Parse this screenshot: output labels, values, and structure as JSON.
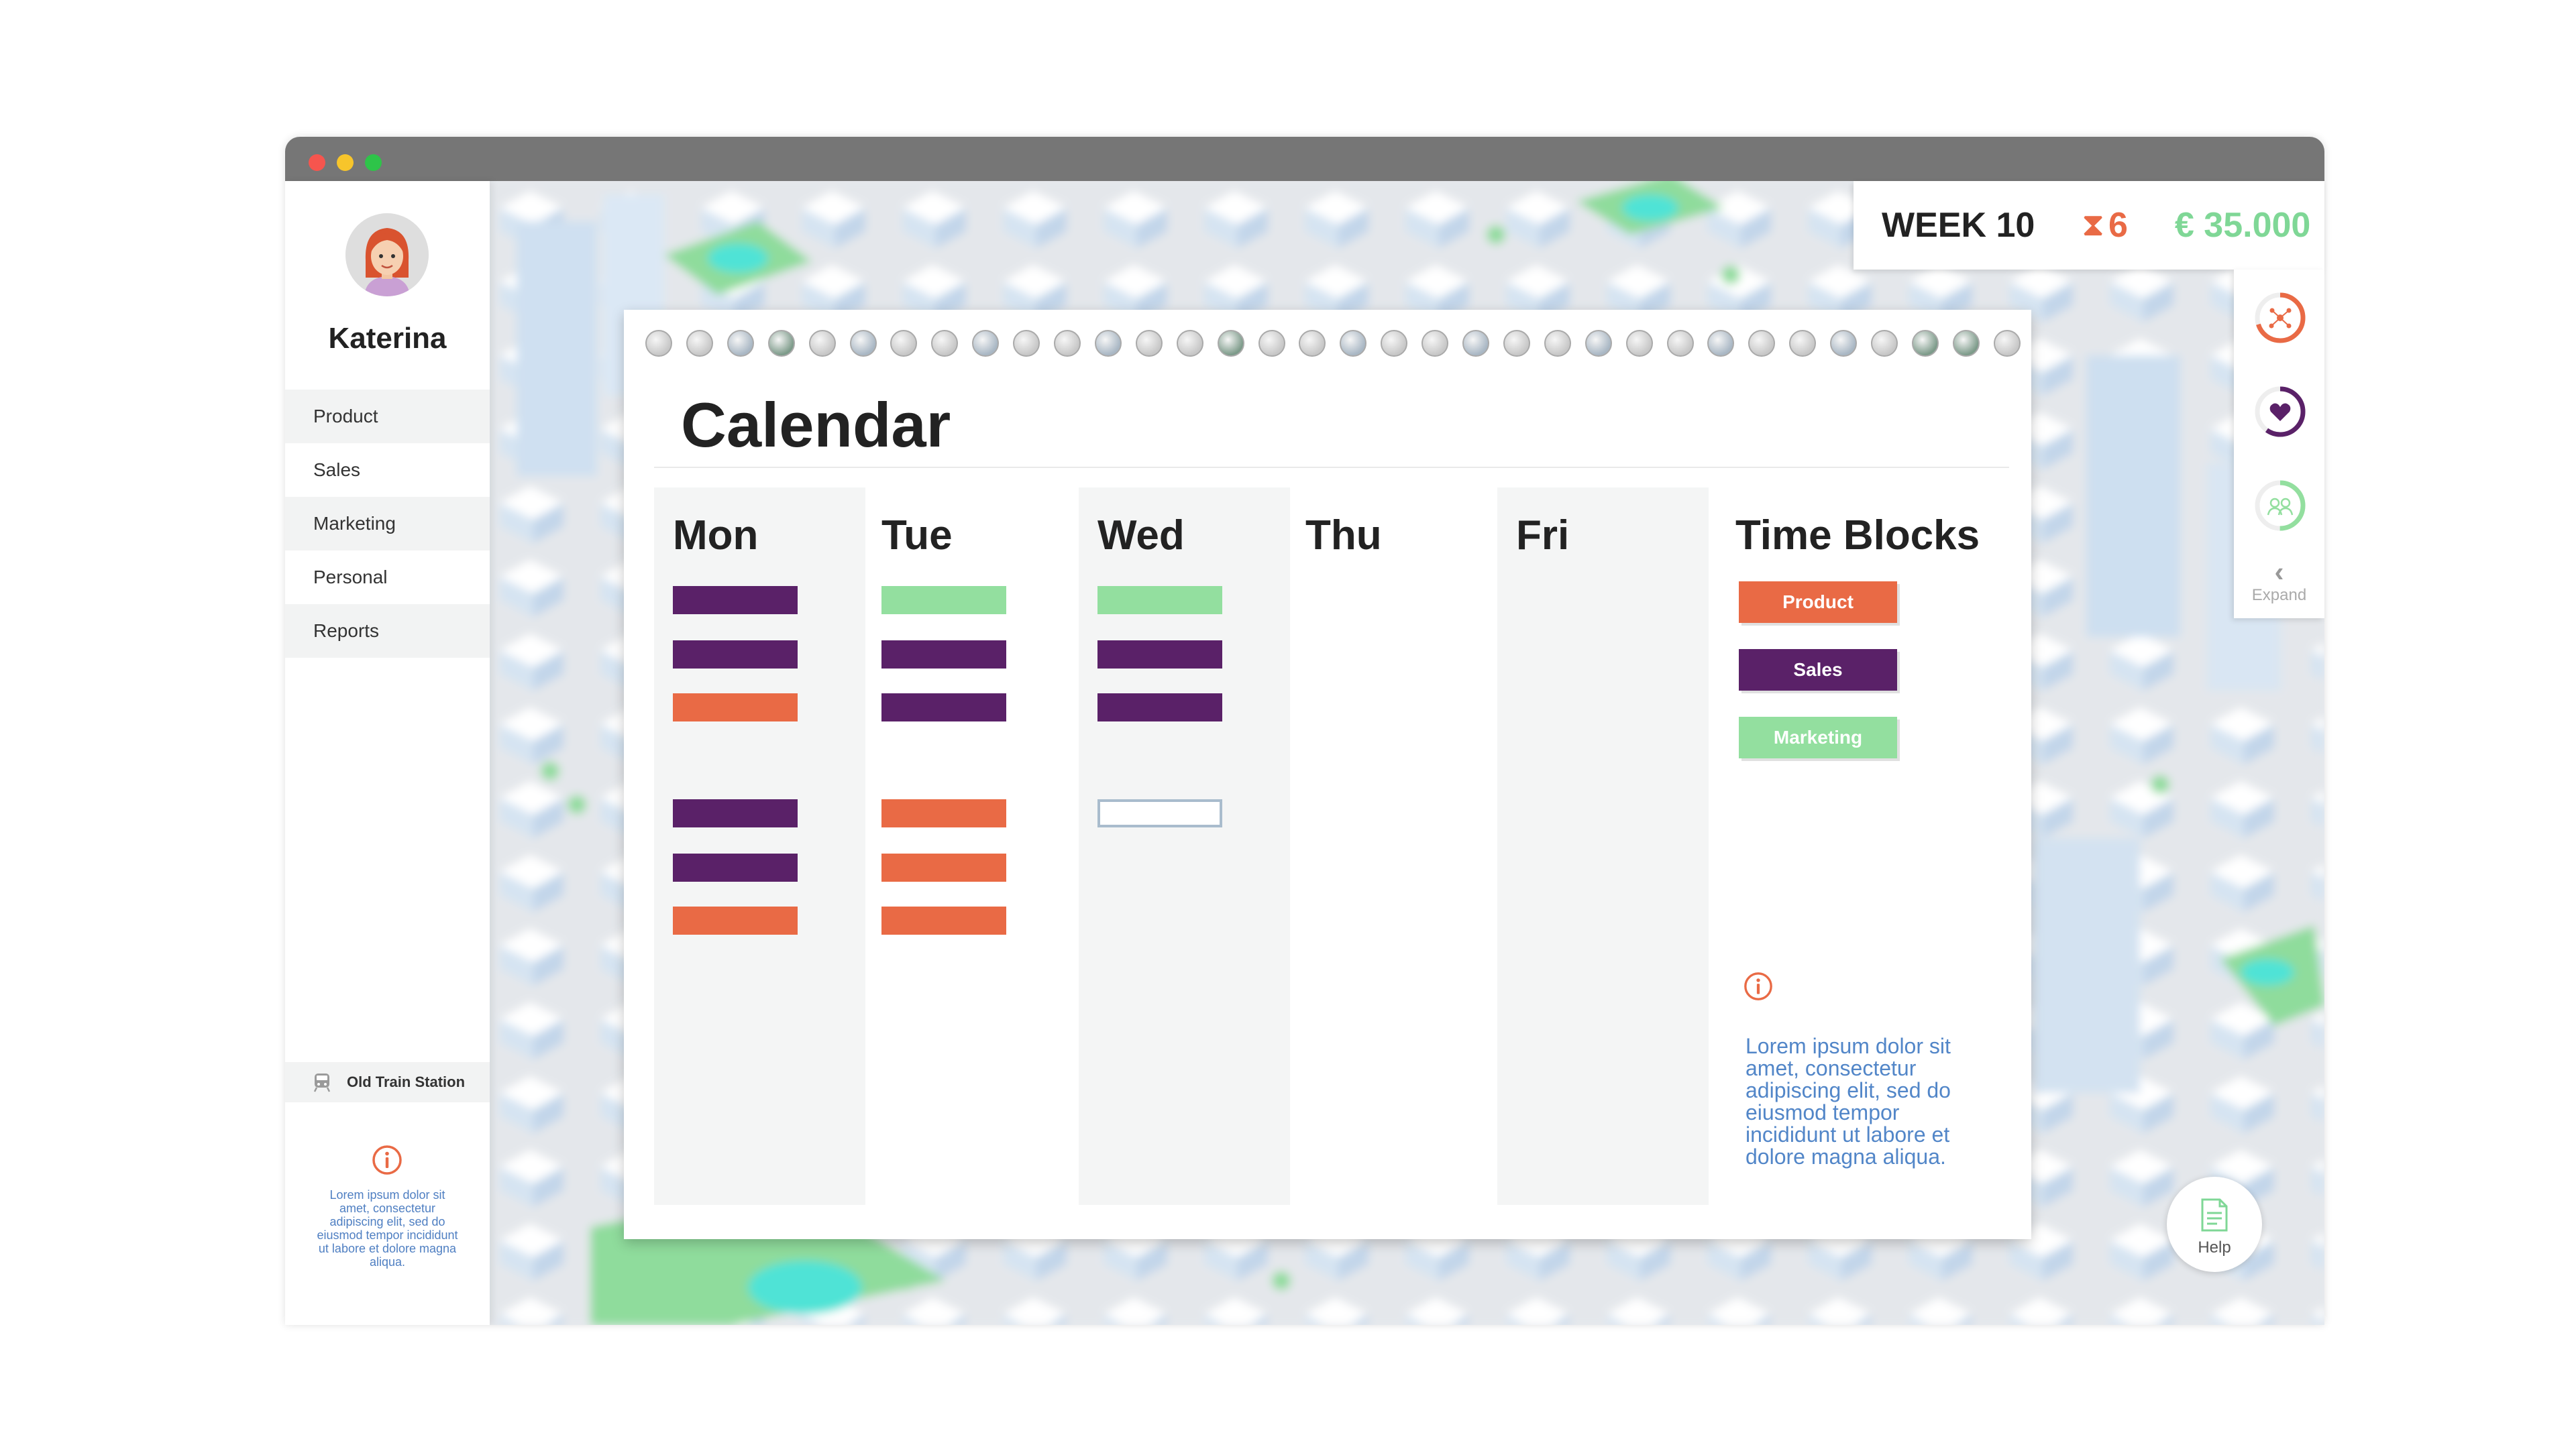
{
  "window": {
    "controls": [
      "close",
      "minimize",
      "maximize"
    ]
  },
  "user": {
    "name": "Katerina",
    "avatar_icon": "woman-avatar-icon"
  },
  "sidebar": {
    "items": [
      {
        "label": "Product"
      },
      {
        "label": "Sales"
      },
      {
        "label": "Marketing"
      },
      {
        "label": "Personal"
      },
      {
        "label": "Reports"
      }
    ],
    "location": {
      "label": "Old Train Station",
      "icon": "train-icon"
    },
    "info_icon": "info-icon",
    "info_text": "Lorem ipsum dolor sit amet, consectetur adipiscing elit, sed do eiusmod tempor incididunt ut labore et dolore magna aliqua."
  },
  "stats": {
    "week": "WEEK 10",
    "time_icon": "hourglass-icon",
    "time_left": "6",
    "money": "€ 35.000"
  },
  "meters": [
    {
      "icon": "network-icon",
      "color": "#e96a45",
      "level": 0.7
    },
    {
      "icon": "heart-icon",
      "color": "#5a2168",
      "level": 0.6
    },
    {
      "icon": "people-icon",
      "color": "#7fd796",
      "level": 0.5
    }
  ],
  "expand": {
    "label": "Expand",
    "icon": "chevron-left-icon"
  },
  "help": {
    "label": "Help",
    "icon": "document-icon"
  },
  "calendar": {
    "title": "Calendar",
    "days": [
      {
        "label": "Mon",
        "blocks": [
          "sales",
          "sales",
          "product",
          null,
          "sales",
          "sales",
          "product"
        ]
      },
      {
        "label": "Tue",
        "blocks": [
          "marketing",
          "sales",
          "sales",
          null,
          "product",
          "product",
          "product"
        ]
      },
      {
        "label": "Wed",
        "blocks": [
          "marketing",
          "sales",
          "sales",
          null,
          "empty"
        ]
      },
      {
        "label": "Thu",
        "blocks": []
      },
      {
        "label": "Fri",
        "blocks": []
      }
    ],
    "time_blocks_heading": "Time Blocks",
    "time_blocks": [
      {
        "label": "Product",
        "type": "product"
      },
      {
        "label": "Sales",
        "type": "sales"
      },
      {
        "label": "Marketing",
        "type": "marketing"
      }
    ],
    "info_icon": "info-icon",
    "info_text": "Lorem ipsum dolor sit amet, consectetur adipiscing elit, sed do eiusmod tempor incididunt ut labore et dolore magna aliqua."
  },
  "colors": {
    "product": "#e96a45",
    "sales": "#5a2168",
    "marketing": "#93df9f",
    "money": "#7fd796",
    "accent": "#e96a45",
    "link_text": "#5286c8"
  }
}
